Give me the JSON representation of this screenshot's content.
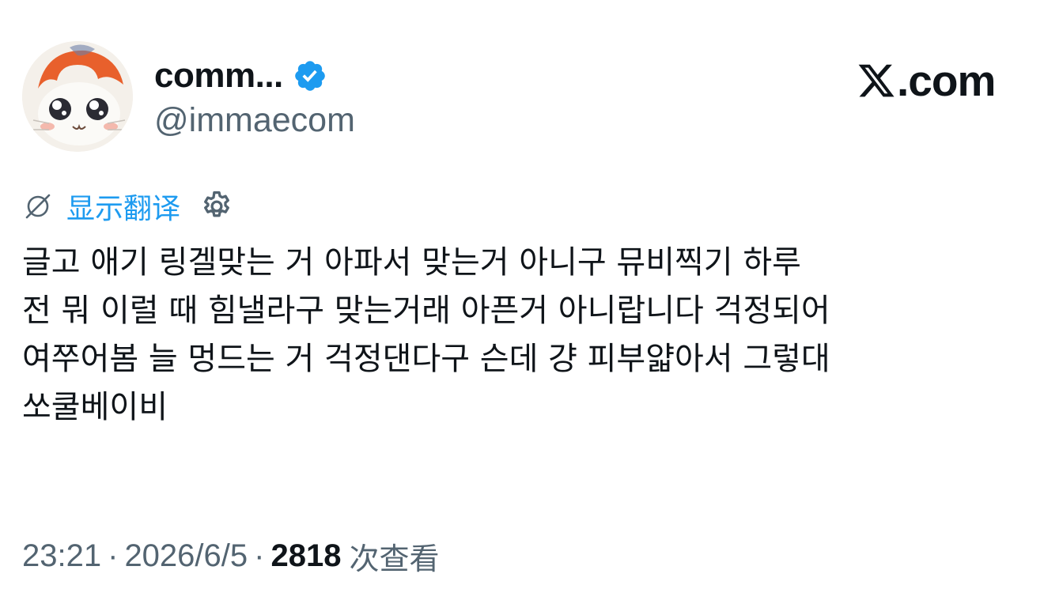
{
  "author": {
    "display_name": "comm...",
    "handle": "@immaecom",
    "verified": true,
    "avatar_icon": "hamster-avatar-icon"
  },
  "brand": {
    "logo_text": ".com",
    "logo_icon": "x-logo-icon"
  },
  "translate": {
    "label": "显示翻译",
    "icon": "translate-icon",
    "settings_icon": "gear-icon"
  },
  "tweet": {
    "lines": [
      "글고 애기 링겔맞는 거 아파서 맞는거 아니구 뮤비찍기 하루",
      "전 뭐 이럴 때 힘낼라구 맞는거래 아픈거 아니랍니다 걱정되어",
      "여쭈어봄 늘 멍드는 거 걱정댄다구 슨데 걍 피부얇아서 그렇대",
      "쏘쿨베이비"
    ]
  },
  "meta": {
    "time": "23:21",
    "separator": "·",
    "date": "2026/6/5",
    "views_count": "2818",
    "views_label": "次查看"
  },
  "colors": {
    "accent": "#1d9bf0",
    "text_primary": "#0f1419",
    "text_secondary": "#536471"
  }
}
